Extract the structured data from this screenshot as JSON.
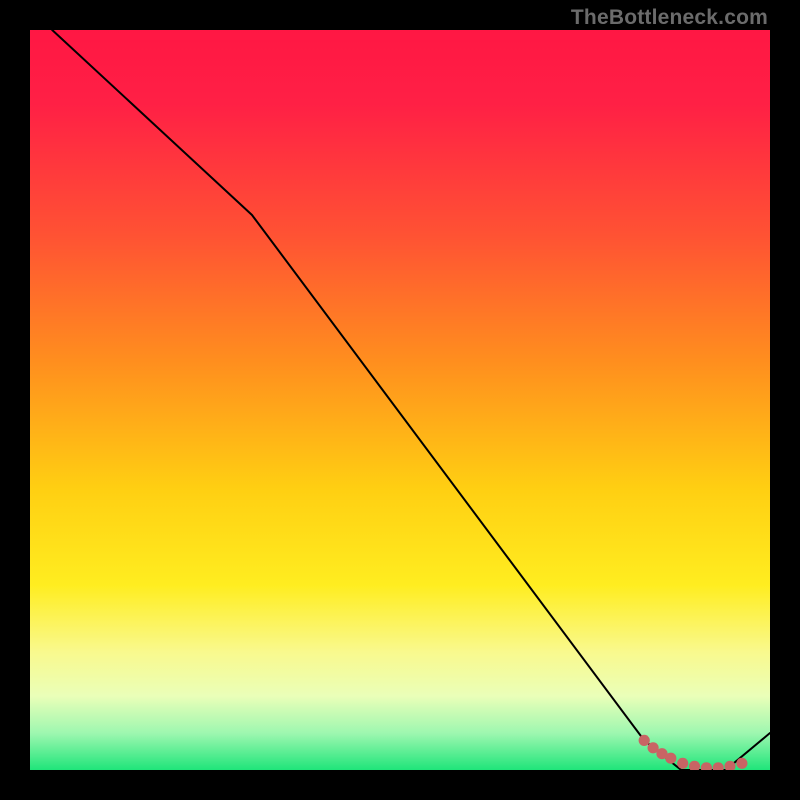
{
  "watermark": "TheBottleneck.com",
  "colors": {
    "bg": "#000000",
    "gradient_stops": [
      {
        "offset": 0,
        "color": "#ff1744"
      },
      {
        "offset": 10,
        "color": "#ff2045"
      },
      {
        "offset": 28,
        "color": "#ff5333"
      },
      {
        "offset": 45,
        "color": "#ff8f1e"
      },
      {
        "offset": 62,
        "color": "#ffcf12"
      },
      {
        "offset": 75,
        "color": "#ffed20"
      },
      {
        "offset": 84,
        "color": "#f9f98d"
      },
      {
        "offset": 90,
        "color": "#eaffb8"
      },
      {
        "offset": 95,
        "color": "#9ef7b0"
      },
      {
        "offset": 100,
        "color": "#1fe57a"
      }
    ],
    "line": "#000000",
    "marker": "#c86464"
  },
  "chart_data": {
    "type": "line",
    "title": "",
    "xlabel": "",
    "ylabel": "",
    "xlim": [
      0,
      100
    ],
    "ylim": [
      0,
      100
    ],
    "series": [
      {
        "name": "curve",
        "x": [
          0,
          3,
          30,
          83,
          88,
          94,
          100
        ],
        "y": [
          105,
          100,
          75,
          4,
          0,
          0,
          5
        ]
      }
    ],
    "markers": {
      "name": "cluster",
      "x": [
        83.0,
        84.2,
        85.4,
        86.6,
        88.2,
        89.8,
        91.4,
        93.0,
        94.6,
        96.2
      ],
      "y": [
        4.0,
        3.0,
        2.2,
        1.6,
        0.9,
        0.5,
        0.3,
        0.3,
        0.5,
        0.9
      ]
    }
  }
}
